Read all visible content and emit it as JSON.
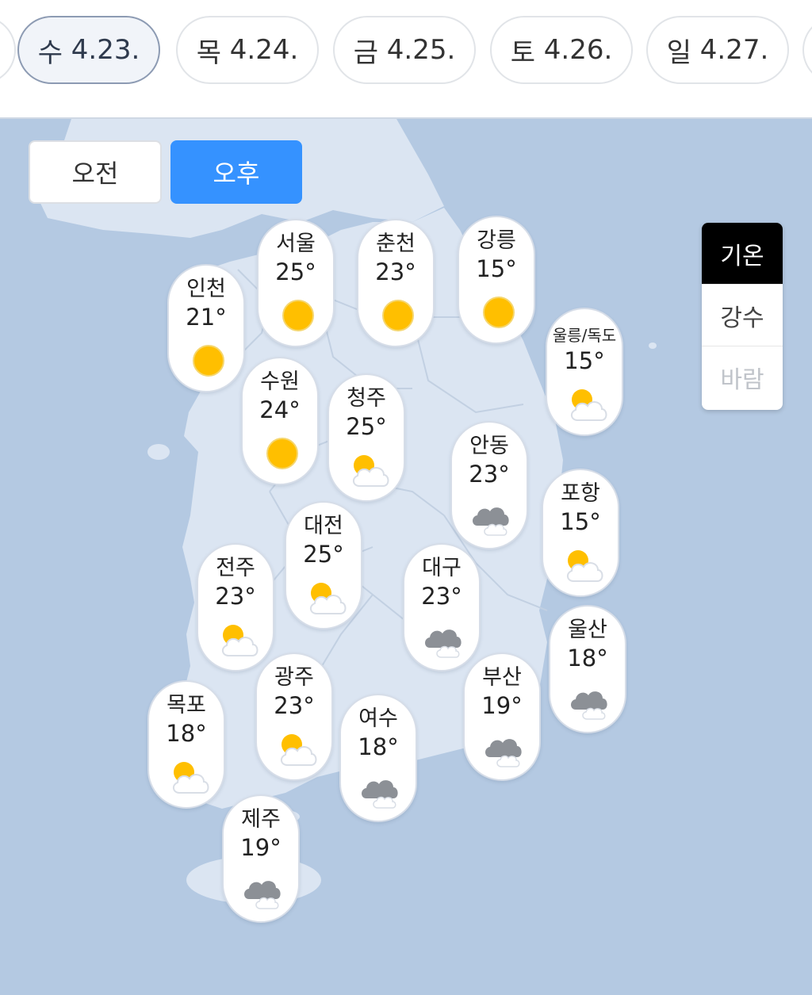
{
  "dates": [
    {
      "day": "수",
      "date": "4.23.",
      "selected": true
    },
    {
      "day": "목",
      "date": "4.24."
    },
    {
      "day": "금",
      "date": "4.25."
    },
    {
      "day": "토",
      "date": "4.26."
    },
    {
      "day": "일",
      "date": "4.27."
    }
  ],
  "ampm": {
    "am": "오전",
    "pm": "오후",
    "selected": "오후"
  },
  "layers": [
    "기온",
    "강수",
    "바람"
  ],
  "colors": {
    "accent": "#3592ff",
    "sun": "#ffbf00",
    "sea": "#b4c9e2",
    "land": "#dbe5f2"
  },
  "cities": [
    {
      "name": "인천",
      "temp": "21°",
      "icon": "sunny-icon"
    },
    {
      "name": "서울",
      "temp": "25°",
      "icon": "sunny-icon"
    },
    {
      "name": "춘천",
      "temp": "23°",
      "icon": "sunny-icon"
    },
    {
      "name": "강릉",
      "temp": "15°",
      "icon": "sunny-icon"
    },
    {
      "name": "울릉/독도",
      "temp": "15°",
      "icon": "partly-cloudy-icon"
    },
    {
      "name": "수원",
      "temp": "24°",
      "icon": "sunny-icon"
    },
    {
      "name": "청주",
      "temp": "25°",
      "icon": "partly-cloudy-icon"
    },
    {
      "name": "안동",
      "temp": "23°",
      "icon": "cloudy-icon"
    },
    {
      "name": "포항",
      "temp": "15°",
      "icon": "partly-cloudy-icon"
    },
    {
      "name": "대전",
      "temp": "25°",
      "icon": "partly-cloudy-icon"
    },
    {
      "name": "전주",
      "temp": "23°",
      "icon": "partly-cloudy-icon"
    },
    {
      "name": "대구",
      "temp": "23°",
      "icon": "cloudy-icon"
    },
    {
      "name": "울산",
      "temp": "18°",
      "icon": "cloudy-icon"
    },
    {
      "name": "광주",
      "temp": "23°",
      "icon": "partly-cloudy-icon"
    },
    {
      "name": "부산",
      "temp": "19°",
      "icon": "cloudy-icon"
    },
    {
      "name": "목포",
      "temp": "18°",
      "icon": "partly-cloudy-icon"
    },
    {
      "name": "여수",
      "temp": "18°",
      "icon": "cloudy-icon"
    },
    {
      "name": "제주",
      "temp": "19°",
      "icon": "cloudy-icon"
    }
  ]
}
